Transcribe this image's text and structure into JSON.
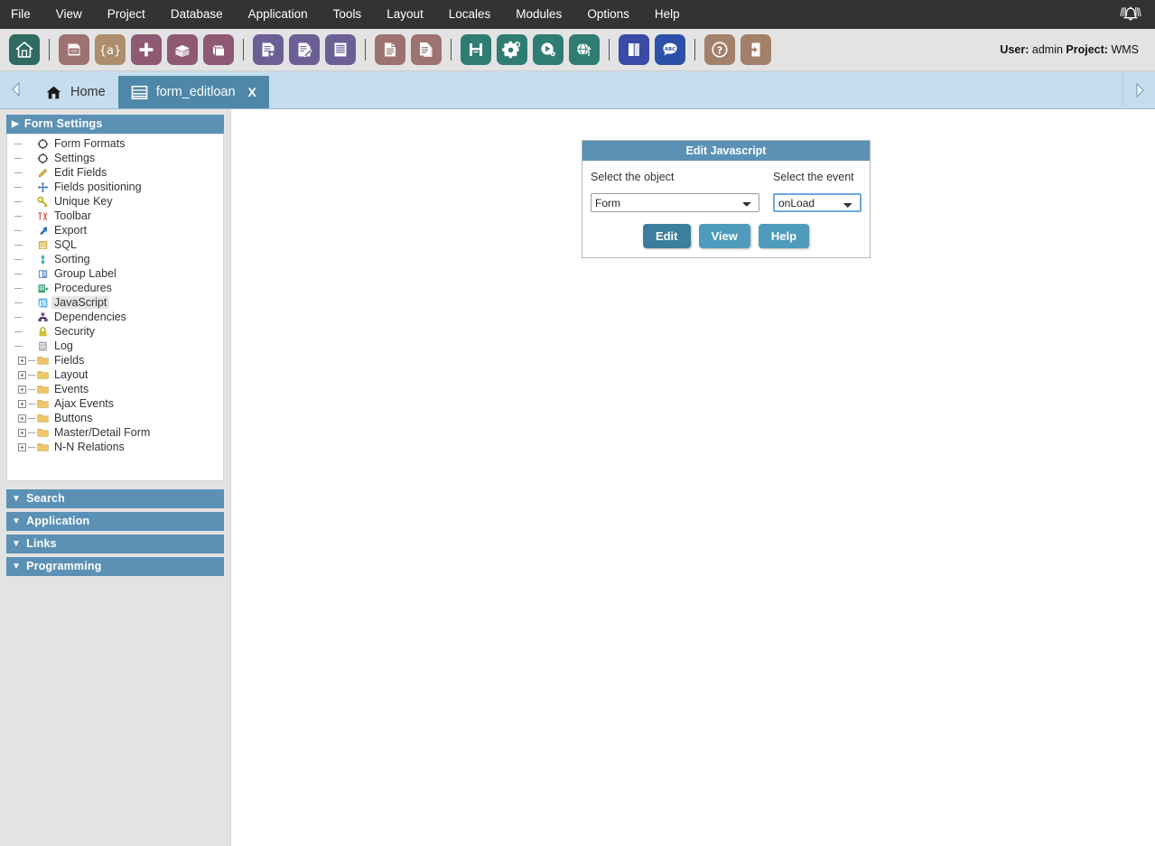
{
  "menubar": {
    "items": [
      {
        "label": "File"
      },
      {
        "label": "View"
      },
      {
        "label": "Project"
      },
      {
        "label": "Database"
      },
      {
        "label": "Application"
      },
      {
        "label": "Tools"
      },
      {
        "label": "Layout"
      },
      {
        "label": "Locales"
      },
      {
        "label": "Modules"
      },
      {
        "label": "Options"
      },
      {
        "label": "Help"
      }
    ],
    "notification_icon": "bell-icon",
    "background": "#333333",
    "text_color": "#ffffff"
  },
  "toolbar": {
    "background": "#e3e3e3",
    "user_label": "User:",
    "user_value": "admin",
    "project_label": "Project:",
    "project_value": "WMS",
    "user_info": "User: admin Project: WMS",
    "groups": [
      {
        "buttons": [
          {
            "icon": "home-icon",
            "color": "#2f6b60",
            "title": "Home"
          }
        ]
      },
      {
        "buttons": [
          {
            "icon": "code-document-icon",
            "color": "#9f7272",
            "title": "New Application"
          },
          {
            "icon": "curly-braces-icon",
            "color": "#ad8d6c",
            "title": "Macro"
          },
          {
            "icon": "plus-icon",
            "color": "#8e5a73",
            "title": "Add"
          },
          {
            "icon": "open-box-icon",
            "color": "#8e5a73",
            "title": "Unpack"
          },
          {
            "icon": "closed-box-icon",
            "color": "#8e5a73",
            "title": "Pack"
          }
        ]
      },
      {
        "buttons": [
          {
            "icon": "document-add-icon",
            "color": "#6b5f96",
            "title": "New Form"
          },
          {
            "icon": "document-edit-icon",
            "color": "#6b5f96",
            "title": "Edit Form"
          },
          {
            "icon": "document-list-icon",
            "color": "#6b5f96",
            "title": "List Form"
          }
        ]
      },
      {
        "buttons": [
          {
            "icon": "page-icon",
            "color": "#9f7272",
            "title": "Page"
          },
          {
            "icon": "pages-copy-icon",
            "color": "#9f7272",
            "title": "Copy Page"
          }
        ]
      },
      {
        "buttons": [
          {
            "icon": "save-floppy-icon",
            "color": "#2f7d72",
            "title": "Save"
          },
          {
            "icon": "gear-icon",
            "color": "#2f7d72",
            "title": "Settings"
          },
          {
            "icon": "run-play-icon",
            "color": "#2f7d72",
            "title": "Run"
          },
          {
            "icon": "globe-upload-icon",
            "color": "#2f7d72",
            "title": "Publish"
          }
        ]
      },
      {
        "buttons": [
          {
            "icon": "book-icon",
            "color": "#3b4aa6",
            "title": "Manual"
          },
          {
            "icon": "abc-bubble-icon",
            "color": "#2b50a8",
            "title": "Dictionary"
          }
        ]
      },
      {
        "buttons": [
          {
            "icon": "question-help-icon",
            "color": "#a3806a",
            "title": "Help"
          },
          {
            "icon": "exit-door-icon",
            "color": "#a3806a",
            "title": "Exit"
          }
        ]
      }
    ]
  },
  "tabbar": {
    "background": "#c5ddee",
    "prev_icon": "chevron-left-icon",
    "next_icon": "chevron-right-icon",
    "tabs": [
      {
        "label": "Home",
        "icon": "home-icon",
        "active": false,
        "closable": false
      },
      {
        "label": "form_editloan",
        "icon": "form-grid-icon",
        "active": true,
        "closable": true,
        "close_label": "X"
      }
    ]
  },
  "sidebar": {
    "accent_color": "#5b91b5",
    "sections": [
      {
        "id": "form-settings",
        "title": "Form Settings",
        "expanded": true,
        "marker": "▶"
      }
    ],
    "tree": [
      {
        "label": "Form Formats",
        "icon": "gear-outline-icon",
        "type": "leaf",
        "selected": false
      },
      {
        "label": "Settings",
        "icon": "gear-outline-icon",
        "type": "leaf",
        "selected": false
      },
      {
        "label": "Edit Fields",
        "icon": "pencil-icon",
        "type": "leaf",
        "selected": false
      },
      {
        "label": "Fields positioning",
        "icon": "move-cross-icon",
        "type": "leaf",
        "selected": false
      },
      {
        "label": "Unique Key",
        "icon": "key-icon",
        "type": "leaf",
        "selected": false
      },
      {
        "label": "Toolbar",
        "icon": "toolbar-icon",
        "type": "leaf",
        "selected": false
      },
      {
        "label": "Export",
        "icon": "export-arrow-icon",
        "type": "leaf",
        "selected": false
      },
      {
        "label": "SQL",
        "icon": "sql-lines-icon",
        "type": "leaf",
        "selected": false
      },
      {
        "label": "Sorting",
        "icon": "sort-updown-icon",
        "type": "leaf",
        "selected": false
      },
      {
        "label": "Group Label",
        "icon": "group-label-icon",
        "type": "leaf",
        "selected": false
      },
      {
        "label": "Procedures",
        "icon": "procedures-icon",
        "type": "leaf",
        "selected": false
      },
      {
        "label": "JavaScript",
        "icon": "js-icon",
        "type": "leaf",
        "selected": true
      },
      {
        "label": "Dependencies",
        "icon": "dependencies-icon",
        "type": "leaf",
        "selected": false
      },
      {
        "label": "Security",
        "icon": "lock-icon",
        "type": "leaf",
        "selected": false
      },
      {
        "label": "Log",
        "icon": "log-icon",
        "type": "leaf",
        "selected": false
      },
      {
        "label": "Fields",
        "icon": "folder-icon",
        "type": "folder",
        "expander": "+",
        "selected": false
      },
      {
        "label": "Layout",
        "icon": "folder-icon",
        "type": "folder",
        "expander": "+",
        "selected": false
      },
      {
        "label": "Events",
        "icon": "folder-icon",
        "type": "folder",
        "expander": "+",
        "selected": false
      },
      {
        "label": "Ajax Events",
        "icon": "folder-icon",
        "type": "folder",
        "expander": "+",
        "selected": false
      },
      {
        "label": "Buttons",
        "icon": "folder-icon",
        "type": "folder",
        "expander": "+",
        "selected": false
      },
      {
        "label": "Master/Detail Form",
        "icon": "folder-icon",
        "type": "folder",
        "expander": "+",
        "selected": false
      },
      {
        "label": "N-N Relations",
        "icon": "folder-icon",
        "type": "folder",
        "expander": "+",
        "selected": false
      }
    ],
    "collapsed_sections": [
      {
        "title": "Search",
        "marker": "▼",
        "expanded": false
      },
      {
        "title": "Application",
        "marker": "▼",
        "expanded": false
      },
      {
        "title": "Links",
        "marker": "▼",
        "expanded": false
      },
      {
        "title": "Programming",
        "marker": "▼",
        "expanded": false
      }
    ]
  },
  "dialog": {
    "title": "Edit Javascript",
    "header_color": "#5b91b5",
    "object_label": "Select the object",
    "event_label": "Select the event",
    "object_select": {
      "value": "Form",
      "options": [
        "Form"
      ]
    },
    "event_select": {
      "value": "onLoad",
      "options": [
        "onLoad"
      ],
      "focused": true,
      "focus_color": "#6ea8dd"
    },
    "buttons": [
      {
        "label": "Edit",
        "style": "primary",
        "color": "#3c7e9e"
      },
      {
        "label": "View",
        "style": "secondary",
        "color": "#4e9bbd"
      },
      {
        "label": "Help",
        "style": "secondary",
        "color": "#4e9bbd"
      }
    ]
  }
}
